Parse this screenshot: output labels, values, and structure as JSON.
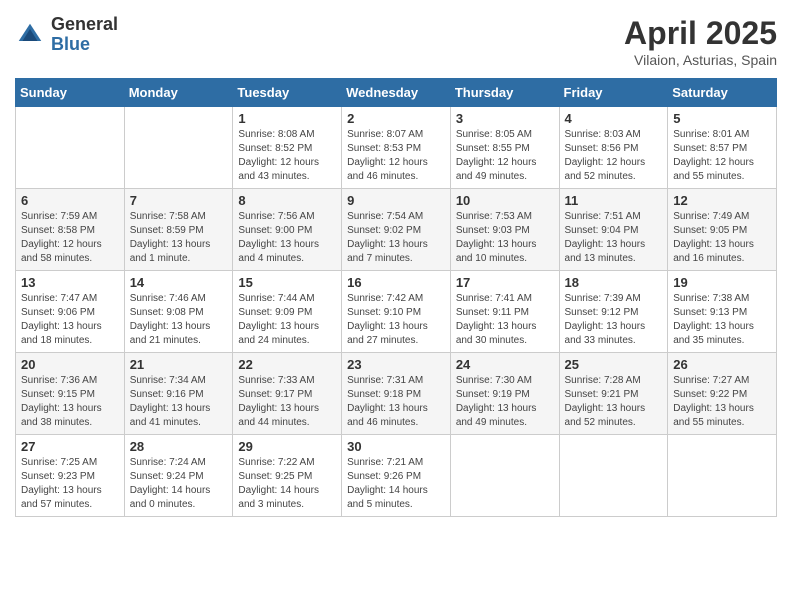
{
  "logo": {
    "general": "General",
    "blue": "Blue"
  },
  "title": "April 2025",
  "subtitle": "Vilaion, Asturias, Spain",
  "headers": [
    "Sunday",
    "Monday",
    "Tuesday",
    "Wednesday",
    "Thursday",
    "Friday",
    "Saturday"
  ],
  "weeks": [
    [
      {
        "day": "",
        "detail": ""
      },
      {
        "day": "",
        "detail": ""
      },
      {
        "day": "1",
        "detail": "Sunrise: 8:08 AM\nSunset: 8:52 PM\nDaylight: 12 hours and 43 minutes."
      },
      {
        "day": "2",
        "detail": "Sunrise: 8:07 AM\nSunset: 8:53 PM\nDaylight: 12 hours and 46 minutes."
      },
      {
        "day": "3",
        "detail": "Sunrise: 8:05 AM\nSunset: 8:55 PM\nDaylight: 12 hours and 49 minutes."
      },
      {
        "day": "4",
        "detail": "Sunrise: 8:03 AM\nSunset: 8:56 PM\nDaylight: 12 hours and 52 minutes."
      },
      {
        "day": "5",
        "detail": "Sunrise: 8:01 AM\nSunset: 8:57 PM\nDaylight: 12 hours and 55 minutes."
      }
    ],
    [
      {
        "day": "6",
        "detail": "Sunrise: 7:59 AM\nSunset: 8:58 PM\nDaylight: 12 hours and 58 minutes."
      },
      {
        "day": "7",
        "detail": "Sunrise: 7:58 AM\nSunset: 8:59 PM\nDaylight: 13 hours and 1 minute."
      },
      {
        "day": "8",
        "detail": "Sunrise: 7:56 AM\nSunset: 9:00 PM\nDaylight: 13 hours and 4 minutes."
      },
      {
        "day": "9",
        "detail": "Sunrise: 7:54 AM\nSunset: 9:02 PM\nDaylight: 13 hours and 7 minutes."
      },
      {
        "day": "10",
        "detail": "Sunrise: 7:53 AM\nSunset: 9:03 PM\nDaylight: 13 hours and 10 minutes."
      },
      {
        "day": "11",
        "detail": "Sunrise: 7:51 AM\nSunset: 9:04 PM\nDaylight: 13 hours and 13 minutes."
      },
      {
        "day": "12",
        "detail": "Sunrise: 7:49 AM\nSunset: 9:05 PM\nDaylight: 13 hours and 16 minutes."
      }
    ],
    [
      {
        "day": "13",
        "detail": "Sunrise: 7:47 AM\nSunset: 9:06 PM\nDaylight: 13 hours and 18 minutes."
      },
      {
        "day": "14",
        "detail": "Sunrise: 7:46 AM\nSunset: 9:08 PM\nDaylight: 13 hours and 21 minutes."
      },
      {
        "day": "15",
        "detail": "Sunrise: 7:44 AM\nSunset: 9:09 PM\nDaylight: 13 hours and 24 minutes."
      },
      {
        "day": "16",
        "detail": "Sunrise: 7:42 AM\nSunset: 9:10 PM\nDaylight: 13 hours and 27 minutes."
      },
      {
        "day": "17",
        "detail": "Sunrise: 7:41 AM\nSunset: 9:11 PM\nDaylight: 13 hours and 30 minutes."
      },
      {
        "day": "18",
        "detail": "Sunrise: 7:39 AM\nSunset: 9:12 PM\nDaylight: 13 hours and 33 minutes."
      },
      {
        "day": "19",
        "detail": "Sunrise: 7:38 AM\nSunset: 9:13 PM\nDaylight: 13 hours and 35 minutes."
      }
    ],
    [
      {
        "day": "20",
        "detail": "Sunrise: 7:36 AM\nSunset: 9:15 PM\nDaylight: 13 hours and 38 minutes."
      },
      {
        "day": "21",
        "detail": "Sunrise: 7:34 AM\nSunset: 9:16 PM\nDaylight: 13 hours and 41 minutes."
      },
      {
        "day": "22",
        "detail": "Sunrise: 7:33 AM\nSunset: 9:17 PM\nDaylight: 13 hours and 44 minutes."
      },
      {
        "day": "23",
        "detail": "Sunrise: 7:31 AM\nSunset: 9:18 PM\nDaylight: 13 hours and 46 minutes."
      },
      {
        "day": "24",
        "detail": "Sunrise: 7:30 AM\nSunset: 9:19 PM\nDaylight: 13 hours and 49 minutes."
      },
      {
        "day": "25",
        "detail": "Sunrise: 7:28 AM\nSunset: 9:21 PM\nDaylight: 13 hours and 52 minutes."
      },
      {
        "day": "26",
        "detail": "Sunrise: 7:27 AM\nSunset: 9:22 PM\nDaylight: 13 hours and 55 minutes."
      }
    ],
    [
      {
        "day": "27",
        "detail": "Sunrise: 7:25 AM\nSunset: 9:23 PM\nDaylight: 13 hours and 57 minutes."
      },
      {
        "day": "28",
        "detail": "Sunrise: 7:24 AM\nSunset: 9:24 PM\nDaylight: 14 hours and 0 minutes."
      },
      {
        "day": "29",
        "detail": "Sunrise: 7:22 AM\nSunset: 9:25 PM\nDaylight: 14 hours and 3 minutes."
      },
      {
        "day": "30",
        "detail": "Sunrise: 7:21 AM\nSunset: 9:26 PM\nDaylight: 14 hours and 5 minutes."
      },
      {
        "day": "",
        "detail": ""
      },
      {
        "day": "",
        "detail": ""
      },
      {
        "day": "",
        "detail": ""
      }
    ]
  ]
}
